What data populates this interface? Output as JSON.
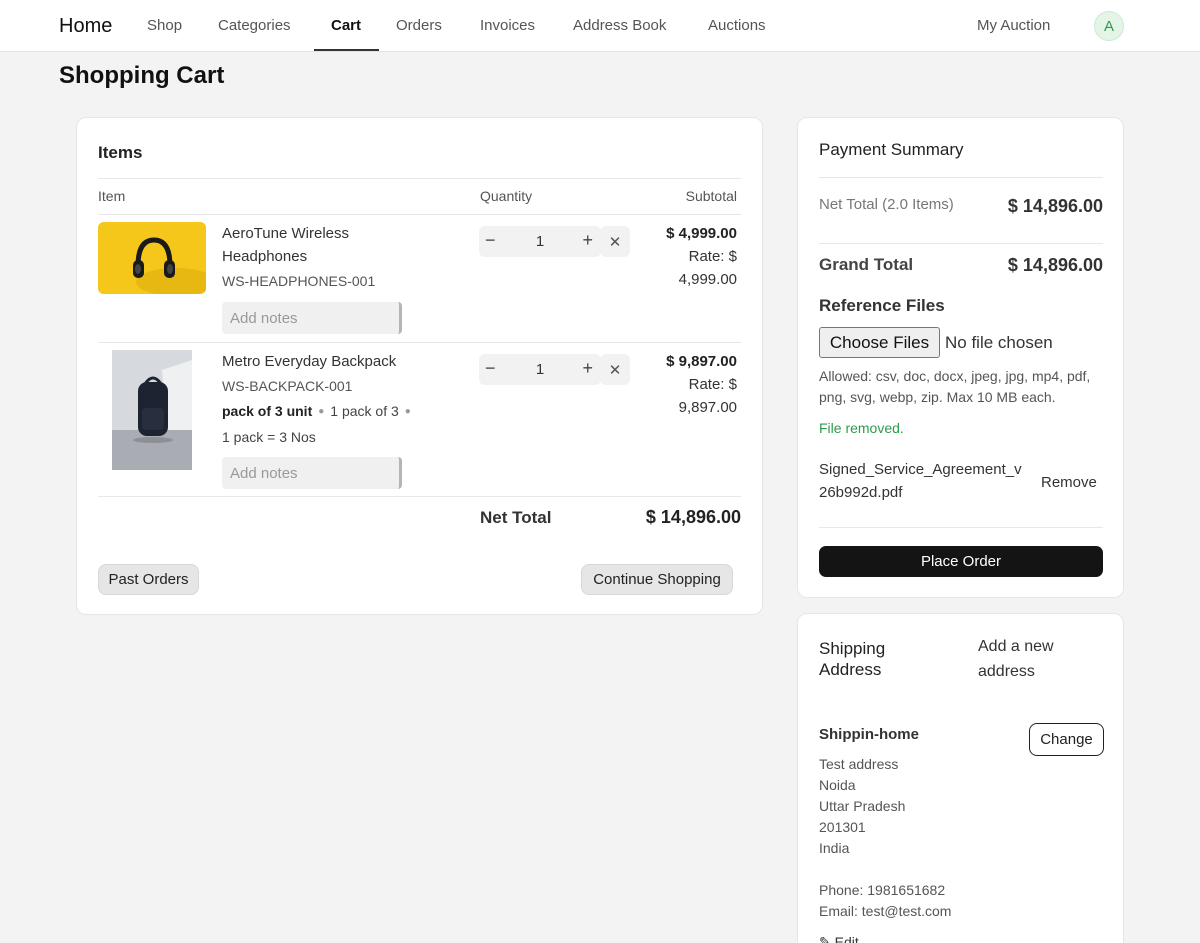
{
  "nav": {
    "home": "Home",
    "links": [
      "Shop",
      "Categories",
      "Cart",
      "Orders",
      "Invoices",
      "Address Book",
      "Auctions"
    ],
    "active": "Cart",
    "my_auction": "My Auction",
    "avatar_letter": "A"
  },
  "page": {
    "title": "Shopping Cart"
  },
  "items_card": {
    "title": "Items",
    "headers": {
      "item": "Item",
      "quantity": "Quantity",
      "subtotal": "Subtotal"
    },
    "items": [
      {
        "name": "AeroTune Wireless Headphones",
        "sku": "WS-HEADPHONES-001",
        "notes_placeholder": "Add notes",
        "quantity": "1",
        "subtotal": "$ 4,999.00",
        "rate_label": "Rate: $",
        "rate_value": "4,999.00"
      },
      {
        "name": "Metro Everyday Backpack",
        "sku": "WS-BACKPACK-001",
        "variant_unit": "pack of 3 unit",
        "variant_pack": "1 pack of 3",
        "conversion": "1 pack = 3 Nos",
        "notes_placeholder": "Add notes",
        "quantity": "1",
        "subtotal": "$ 9,897.00",
        "rate_label": "Rate: $",
        "rate_value": "9,897.00"
      }
    ],
    "net_total_label": "Net Total",
    "net_total_value": "$ 14,896.00",
    "past_orders": "Past Orders",
    "continue_shopping": "Continue Shopping"
  },
  "payment": {
    "title": "Payment Summary",
    "net_total_label": "Net Total (2.0 Items)",
    "net_total_value": "$ 14,896.00",
    "grand_total_label": "Grand Total",
    "grand_total_value": "$ 14,896.00",
    "ref_files_title": "Reference Files",
    "choose_files": "Choose Files",
    "no_file": "No file chosen",
    "allowed": "Allowed: csv, doc, docx, jpeg, jpg, mp4, pdf, png, svg, webp, zip. Max 10 MB each.",
    "removed_msg": "File removed.",
    "file_name": "Signed_Service_Agreement_v26b992d.pdf",
    "remove": "Remove",
    "place_order": "Place Order"
  },
  "shipping": {
    "title": "Shipping Address",
    "add_new": "Add a new address",
    "name": "Shippin-home",
    "change": "Change",
    "address_lines": [
      "Test address",
      "Noida",
      "Uttar Pradesh",
      "201301",
      "India"
    ],
    "phone": "Phone: 1981651682",
    "email": "Email: test@test.com",
    "edit": "Edit"
  },
  "colors": {
    "accent": "#141414",
    "success": "#2e9b4c",
    "avatar_bg": "#e4f5e7"
  }
}
